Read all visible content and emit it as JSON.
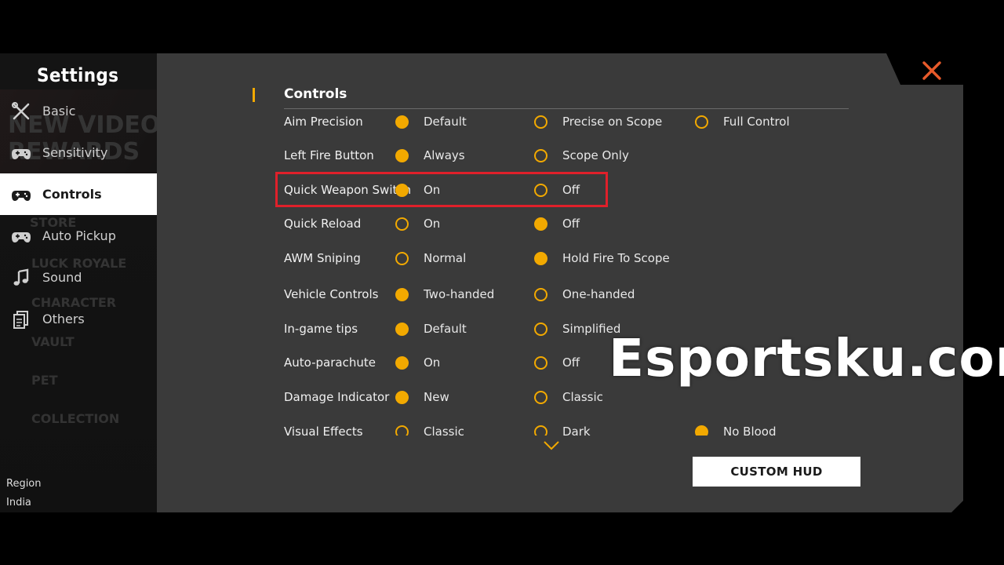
{
  "sidebar": {
    "title": "Settings",
    "background_texts": [
      "NEW VIDEO",
      "REWARDS",
      "STORE",
      "LUCK ROYALE",
      "CHARACTER",
      "VAULT",
      "PET",
      "COLLECTION"
    ],
    "items": [
      {
        "label": "Basic",
        "icon": "tools-icon",
        "active": false
      },
      {
        "label": "Sensitivity",
        "icon": "gamepad-icon",
        "active": false
      },
      {
        "label": "Controls",
        "icon": "gamepad-icon",
        "active": true
      },
      {
        "label": "Auto Pickup",
        "icon": "gamepad-icon",
        "active": false
      },
      {
        "label": "Sound",
        "icon": "music-note-icon",
        "active": false
      },
      {
        "label": "Others",
        "icon": "documents-icon",
        "active": false
      }
    ],
    "region_label": "Region",
    "region_value": "India"
  },
  "main": {
    "section_title": "Controls",
    "rows": [
      {
        "label": "Aim Precision",
        "options": [
          {
            "text": "Default",
            "selected": true
          },
          {
            "text": "Precise on Scope",
            "selected": false
          },
          {
            "text": "Full Control",
            "selected": false
          }
        ]
      },
      {
        "label": "Left Fire Button",
        "options": [
          {
            "text": "Always",
            "selected": true
          },
          {
            "text": "Scope Only",
            "selected": false
          }
        ]
      },
      {
        "label": "Quick Weapon Switch",
        "options": [
          {
            "text": "On",
            "selected": true
          },
          {
            "text": "Off",
            "selected": false
          }
        ]
      },
      {
        "label": "Quick Reload",
        "options": [
          {
            "text": "On",
            "selected": false
          },
          {
            "text": "Off",
            "selected": true
          }
        ]
      },
      {
        "label": "AWM Sniping",
        "options": [
          {
            "text": "Normal",
            "selected": false
          },
          {
            "text": "Hold Fire To Scope",
            "selected": true
          }
        ]
      },
      {
        "label": "Vehicle Controls",
        "options": [
          {
            "text": "Two-handed",
            "selected": true
          },
          {
            "text": "One-handed",
            "selected": false
          }
        ]
      },
      {
        "label": "In-game tips",
        "options": [
          {
            "text": "Default",
            "selected": true
          },
          {
            "text": "Simplified",
            "selected": false
          }
        ]
      },
      {
        "label": "Auto-parachute",
        "options": [
          {
            "text": "On",
            "selected": true
          },
          {
            "text": "Off",
            "selected": false
          }
        ]
      },
      {
        "label": "Damage Indicator",
        "options": [
          {
            "text": "New",
            "selected": true
          },
          {
            "text": "Classic",
            "selected": false
          }
        ]
      },
      {
        "label": "Visual Effects",
        "options": [
          {
            "text": "Classic",
            "selected": false
          },
          {
            "text": "Dark",
            "selected": false
          },
          {
            "text": "No Blood",
            "selected": true
          }
        ]
      }
    ],
    "custom_hud_label": "CUSTOM HUD"
  },
  "watermark": "Esportsku.com",
  "colors": {
    "accent": "#f2a900",
    "highlight_box": "#e0202a",
    "panel_bg": "#3a3a3a",
    "close": "#e85a2a"
  }
}
